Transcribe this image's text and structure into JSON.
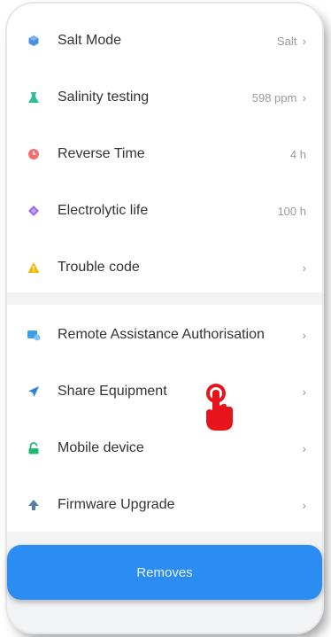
{
  "settings": {
    "items": [
      {
        "label": "Salt Mode",
        "value": "Salt",
        "chevron": "›",
        "icon": "hexagon-icon"
      },
      {
        "label": "Salinity testing",
        "value": "598 ppm",
        "chevron": "›",
        "icon": "flask-icon"
      },
      {
        "label": "Reverse Time",
        "value": "4 h",
        "chevron": "",
        "icon": "clock-icon"
      },
      {
        "label": "Electrolytic life",
        "value": "100 h",
        "chevron": "",
        "icon": "diamond-icon"
      },
      {
        "label": "Trouble code",
        "value": "",
        "chevron": "›",
        "icon": "warning-icon"
      }
    ]
  },
  "device": {
    "items": [
      {
        "label": "Remote Assistance Authorisation",
        "chevron": "›",
        "icon": "remote-assist-icon"
      },
      {
        "label": "Share Equipment",
        "chevron": "›",
        "icon": "send-icon"
      },
      {
        "label": "Mobile device",
        "chevron": "›",
        "icon": "unlock-icon"
      },
      {
        "label": "Firmware Upgrade",
        "chevron": "›",
        "icon": "upload-arrow-icon"
      }
    ]
  },
  "actions": {
    "remove_label": "Removes"
  },
  "colors": {
    "accent": "#2b8cf2",
    "pointer": "#e8141b"
  }
}
